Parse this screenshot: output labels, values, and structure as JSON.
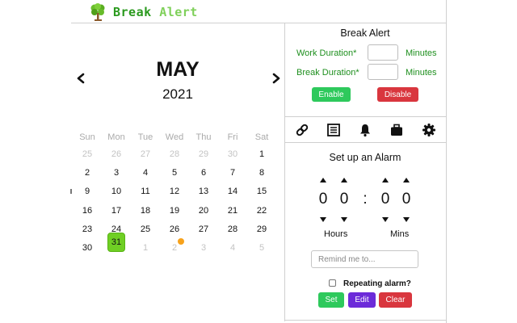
{
  "header": {
    "brand_part1": "Break",
    "brand_part2": "Alert",
    "logo_icon": "tree-icon"
  },
  "calendar": {
    "month": "MAY",
    "year": "2021",
    "weekdays": [
      "Sun",
      "Mon",
      "Tue",
      "Wed",
      "Thu",
      "Fri",
      "Sat"
    ],
    "days": [
      {
        "d": "25",
        "muted": true
      },
      {
        "d": "26",
        "muted": true
      },
      {
        "d": "27",
        "muted": true
      },
      {
        "d": "28",
        "muted": true
      },
      {
        "d": "29",
        "muted": true
      },
      {
        "d": "30",
        "muted": true
      },
      {
        "d": "1",
        "muted": false
      },
      {
        "d": "2",
        "muted": false
      },
      {
        "d": "3",
        "muted": false
      },
      {
        "d": "4",
        "muted": false
      },
      {
        "d": "5",
        "muted": false
      },
      {
        "d": "6",
        "muted": false
      },
      {
        "d": "7",
        "muted": false
      },
      {
        "d": "8",
        "muted": false
      },
      {
        "d": "9",
        "muted": false
      },
      {
        "d": "10",
        "muted": false
      },
      {
        "d": "11",
        "muted": false
      },
      {
        "d": "12",
        "muted": false
      },
      {
        "d": "13",
        "muted": false
      },
      {
        "d": "14",
        "muted": false
      },
      {
        "d": "15",
        "muted": false
      },
      {
        "d": "16",
        "muted": false
      },
      {
        "d": "17",
        "muted": false
      },
      {
        "d": "18",
        "muted": false
      },
      {
        "d": "19",
        "muted": false
      },
      {
        "d": "20",
        "muted": false
      },
      {
        "d": "21",
        "muted": false
      },
      {
        "d": "22",
        "muted": false
      },
      {
        "d": "23",
        "muted": false
      },
      {
        "d": "24",
        "muted": false
      },
      {
        "d": "25",
        "muted": false
      },
      {
        "d": "26",
        "muted": false
      },
      {
        "d": "27",
        "muted": false
      },
      {
        "d": "28",
        "muted": false
      },
      {
        "d": "29",
        "muted": false
      },
      {
        "d": "30",
        "muted": false
      },
      {
        "d": "31",
        "muted": false,
        "today": true
      },
      {
        "d": "1",
        "muted": true
      },
      {
        "d": "2",
        "muted": true
      },
      {
        "d": "3",
        "muted": true
      },
      {
        "d": "4",
        "muted": true
      },
      {
        "d": "5",
        "muted": true
      }
    ],
    "today_color": "#6fcf24",
    "event_dot_color": "#f7a21b"
  },
  "break_alert": {
    "title": "Break Alert",
    "work_label": "Work Duration*",
    "work_value": "",
    "break_label": "Break Duration*",
    "break_value": "",
    "units": "Minutes",
    "enable_label": "Enable",
    "disable_label": "Disable",
    "enable_color": "#2ec95c",
    "disable_color": "#d9363e"
  },
  "toolbar": {
    "icons": [
      "link-icon",
      "list-icon",
      "bell-icon",
      "briefcase-icon",
      "gear-icon"
    ]
  },
  "alarm": {
    "title": "Set up an Alarm",
    "hours": [
      "0",
      "0"
    ],
    "mins": [
      "0",
      "0"
    ],
    "separator": ":",
    "hours_label": "Hours",
    "mins_label": "Mins",
    "remind_placeholder": "Remind me to...",
    "remind_value": "",
    "repeating_label": "Repeating alarm?",
    "repeating_checked": false,
    "set_label": "Set",
    "edit_label": "Edit",
    "clear_label": "Clear",
    "edit_color": "#6c2bd9"
  }
}
